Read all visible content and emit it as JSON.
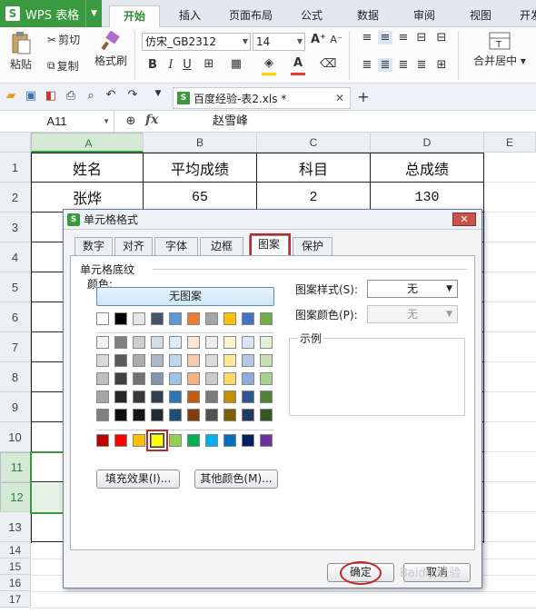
{
  "app": {
    "name": "WPS 表格"
  },
  "ribbon_tabs": [
    "开始",
    "插入",
    "页面布局",
    "公式",
    "数据",
    "审阅",
    "视图",
    "开发"
  ],
  "ribbon": {
    "paste": "粘贴",
    "cut": "剪切",
    "copy": "复制",
    "format_painter": "格式刷",
    "font_name": "仿宋_GB2312",
    "font_size": "14",
    "bold": "B",
    "italic": "I",
    "underline": "U",
    "merge_center": "合并居中",
    "font_color": "#e53935",
    "fill_color": "#ffd400"
  },
  "document_tab": {
    "label": "百度经验-表2.xls *"
  },
  "formula_bar": {
    "name_box": "A11",
    "fx": "fx",
    "content": "赵雪峰"
  },
  "sheet": {
    "columns": [
      "A",
      "B",
      "C",
      "D",
      "E"
    ],
    "rows": [
      "1",
      "2",
      "3",
      "4",
      "5",
      "6",
      "7",
      "8",
      "9",
      "10",
      "11",
      "12",
      "13",
      "14",
      "15",
      "16",
      "17"
    ],
    "header_row": [
      "姓名",
      "平均成绩",
      "科目",
      "总成绩"
    ],
    "data_row": [
      "张烨",
      "65",
      "2",
      "130"
    ]
  },
  "dialog": {
    "title": "单元格格式",
    "tabs": [
      "数字",
      "对齐",
      "字体",
      "边框",
      "图案",
      "保护"
    ],
    "active_tab": "图案",
    "section_title": "单元格底纹",
    "color_label": "颜色:",
    "no_pattern_button": "无图案",
    "pattern_style_label": "图案样式(S):",
    "pattern_style_value": "无",
    "pattern_color_label": "图案颜色(P):",
    "pattern_color_value": "无",
    "sample_label": "示例",
    "fill_effect_button": "填充效果(I)...",
    "more_colors_button": "其他颜色(M)...",
    "ok_button": "确定",
    "cancel_button": "取消",
    "palette_top": [
      "#ffffff",
      "#000000",
      "#e7e6e6",
      "#44546a",
      "#5b9bd5",
      "#ed7d31",
      "#a5a5a5",
      "#ffc000",
      "#4472c4",
      "#70ad47"
    ],
    "palette_tints": [
      [
        "#f2f2f2",
        "#808080",
        "#d0cece",
        "#d6dce5",
        "#deebf7",
        "#fbe5d6",
        "#ededed",
        "#fff2cc",
        "#dae3f3",
        "#e2f0d9"
      ],
      [
        "#d9d9d9",
        "#595959",
        "#aeabab",
        "#adb9ca",
        "#bdd7ee",
        "#f8cbad",
        "#dbdbdb",
        "#ffe699",
        "#b4c7e7",
        "#c5e0b4"
      ],
      [
        "#bfbfbf",
        "#404040",
        "#757171",
        "#8497b0",
        "#9dc3e6",
        "#f4b183",
        "#c9c9c9",
        "#ffd966",
        "#8faadc",
        "#a9d18e"
      ],
      [
        "#a6a6a6",
        "#262626",
        "#3b3838",
        "#333f50",
        "#2e75b6",
        "#c55a11",
        "#7b7b7b",
        "#bf9000",
        "#2f5597",
        "#548235"
      ],
      [
        "#7f7f7f",
        "#0d0d0d",
        "#171515",
        "#222a35",
        "#1f4e79",
        "#843c0c",
        "#525252",
        "#7f6000",
        "#203864",
        "#385723"
      ]
    ],
    "palette_standard": [
      "#c00000",
      "#ff0000",
      "#ffc000",
      "#ffff00",
      "#92d050",
      "#00b050",
      "#00b0f0",
      "#0070c0",
      "#002060",
      "#7030a0"
    ],
    "selected_color": "#ffff00"
  },
  "watermark": "Baidu 经验"
}
